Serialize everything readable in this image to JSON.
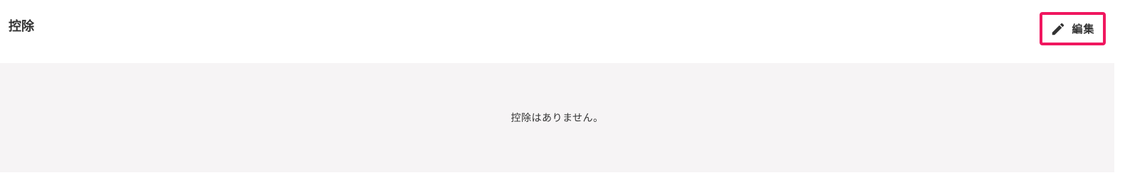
{
  "section": {
    "title": "控除"
  },
  "toolbar": {
    "edit_label": "編集",
    "edit_icon": "pencil-icon",
    "highlight_color": "#f0175f"
  },
  "empty_state": {
    "message": "控除はありません。",
    "background_color": "#f6f4f5"
  }
}
